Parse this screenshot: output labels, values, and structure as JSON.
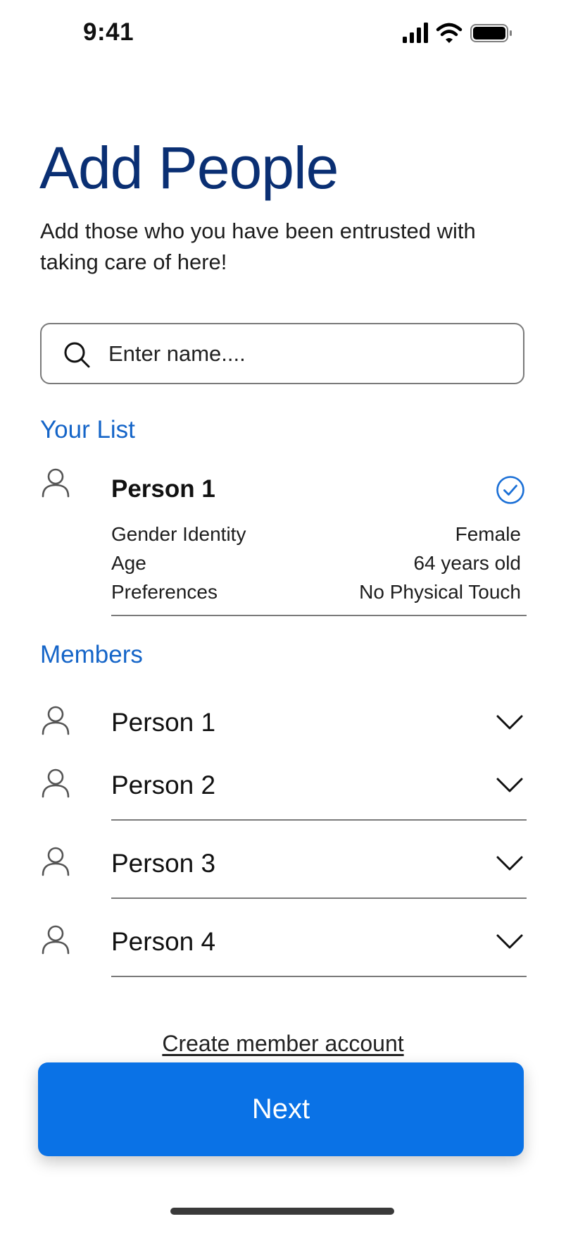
{
  "status_bar": {
    "time": "9:41",
    "icons": [
      "signal-icon",
      "wifi-icon",
      "battery-icon"
    ]
  },
  "header": {
    "title": "Add People",
    "subtitle": "Add those who you have been entrusted with taking care of here!"
  },
  "search": {
    "placeholder": "Enter name....",
    "value": ""
  },
  "your_list": {
    "heading": "Your List",
    "person": {
      "name": "Person 1",
      "selected": true,
      "details": [
        {
          "label": "Gender Identity",
          "value": "Female"
        },
        {
          "label": "Age",
          "value": "64 years old"
        },
        {
          "label": "Preferences",
          "value": "No Physical Touch"
        }
      ]
    }
  },
  "members": {
    "heading": "Members",
    "items": [
      {
        "name": "Person 1"
      },
      {
        "name": "Person 2"
      },
      {
        "name": "Person 3"
      },
      {
        "name": "Person 4"
      }
    ]
  },
  "footer": {
    "create_link": "Create member account",
    "next_label": "Next"
  },
  "colors": {
    "title": "#0a2f73",
    "accent": "#1565c8",
    "button": "#0a72e6"
  }
}
